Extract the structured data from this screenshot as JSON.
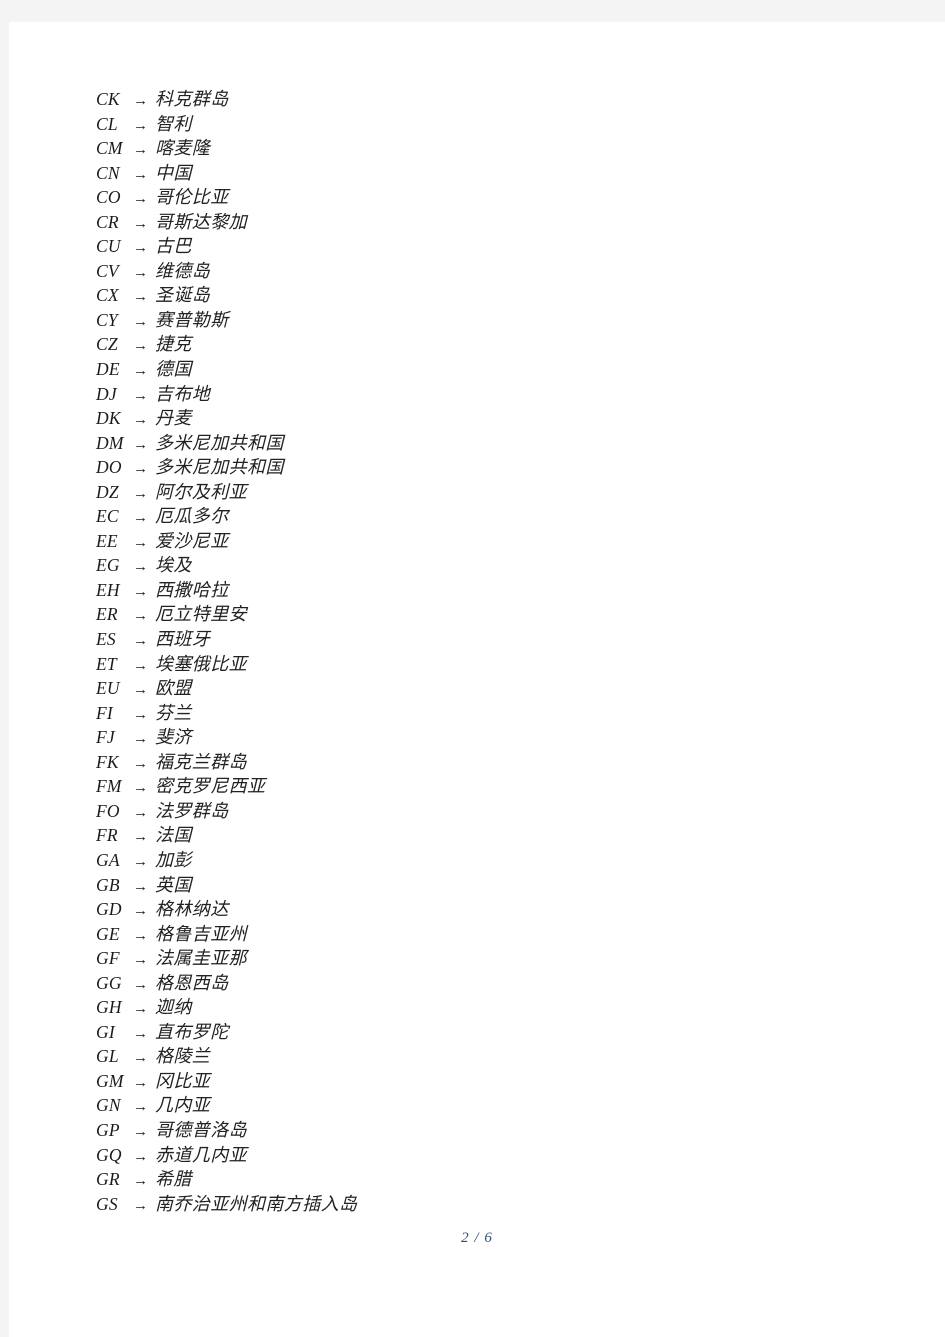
{
  "document": {
    "type": "country-code-mapping-list",
    "arrow_glyph": "→",
    "footer": "2 / 6",
    "colors": {
      "page_background": "#ffffff",
      "margin_background": "#f4f4f4",
      "text": "#222222",
      "footer_text": "#31507e"
    }
  },
  "entries": [
    {
      "code": "CK",
      "arrow": "→",
      "name": "科克群岛"
    },
    {
      "code": "CL",
      "arrow": "→",
      "name": "智利"
    },
    {
      "code": "CM",
      "arrow": "→",
      "name": "喀麦隆"
    },
    {
      "code": "CN",
      "arrow": "→",
      "name": "中国"
    },
    {
      "code": "CO",
      "arrow": "→",
      "name": "哥伦比亚"
    },
    {
      "code": "CR",
      "arrow": "→",
      "name": "哥斯达黎加"
    },
    {
      "code": "CU",
      "arrow": "→",
      "name": "古巴"
    },
    {
      "code": "CV",
      "arrow": "→",
      "name": "维德岛"
    },
    {
      "code": "CX",
      "arrow": "→",
      "name": "圣诞岛"
    },
    {
      "code": "CY",
      "arrow": "→",
      "name": "赛普勒斯"
    },
    {
      "code": "CZ",
      "arrow": "→",
      "name": "捷克"
    },
    {
      "code": "DE",
      "arrow": "→",
      "name": "德国"
    },
    {
      "code": "DJ",
      "arrow": "→",
      "name": "吉布地"
    },
    {
      "code": "DK",
      "arrow": "→",
      "name": "丹麦"
    },
    {
      "code": "DM",
      "arrow": "→",
      "name": "多米尼加共和国"
    },
    {
      "code": "DO",
      "arrow": "→",
      "name": "多米尼加共和国"
    },
    {
      "code": "DZ",
      "arrow": "→",
      "name": "阿尔及利亚"
    },
    {
      "code": "EC",
      "arrow": "→",
      "name": "厄瓜多尔"
    },
    {
      "code": "EE",
      "arrow": "→",
      "name": "爱沙尼亚"
    },
    {
      "code": "EG",
      "arrow": "→",
      "name": "埃及"
    },
    {
      "code": "EH",
      "arrow": "→",
      "name": "西撒哈拉"
    },
    {
      "code": "ER",
      "arrow": "→",
      "name": "厄立特里安"
    },
    {
      "code": "ES",
      "arrow": "→",
      "name": "西班牙"
    },
    {
      "code": "ET",
      "arrow": "→",
      "name": "埃塞俄比亚"
    },
    {
      "code": "EU",
      "arrow": "→",
      "name": "欧盟"
    },
    {
      "code": "FI",
      "arrow": "→",
      "name": "芬兰"
    },
    {
      "code": "FJ",
      "arrow": "→",
      "name": "斐济"
    },
    {
      "code": "FK",
      "arrow": "→",
      "name": "福克兰群岛"
    },
    {
      "code": "FM",
      "arrow": "→",
      "name": "密克罗尼西亚"
    },
    {
      "code": "FO",
      "arrow": "→",
      "name": "法罗群岛"
    },
    {
      "code": "FR",
      "arrow": "→",
      "name": "法国"
    },
    {
      "code": "GA",
      "arrow": "→",
      "name": "加彭"
    },
    {
      "code": "GB",
      "arrow": "→",
      "name": "英国"
    },
    {
      "code": "GD",
      "arrow": "→",
      "name": "格林纳达"
    },
    {
      "code": "GE",
      "arrow": "→",
      "name": "格鲁吉亚州"
    },
    {
      "code": "GF",
      "arrow": "→",
      "name": "法属圭亚那"
    },
    {
      "code": "GG",
      "arrow": "→",
      "name": "格恩西岛"
    },
    {
      "code": "GH",
      "arrow": "→",
      "name": "迦纳"
    },
    {
      "code": "GI",
      "arrow": "→",
      "name": "直布罗陀"
    },
    {
      "code": "GL",
      "arrow": "→",
      "name": "格陵兰"
    },
    {
      "code": "GM",
      "arrow": "→",
      "name": "冈比亚"
    },
    {
      "code": "GN",
      "arrow": "→",
      "name": "几内亚"
    },
    {
      "code": "GP",
      "arrow": "→",
      "name": "哥德普洛岛"
    },
    {
      "code": "GQ",
      "arrow": "→",
      "name": "赤道几内亚"
    },
    {
      "code": "GR",
      "arrow": "→",
      "name": "希腊"
    },
    {
      "code": "GS",
      "arrow": "→",
      "name": "南乔治亚州和南方插入岛"
    }
  ]
}
